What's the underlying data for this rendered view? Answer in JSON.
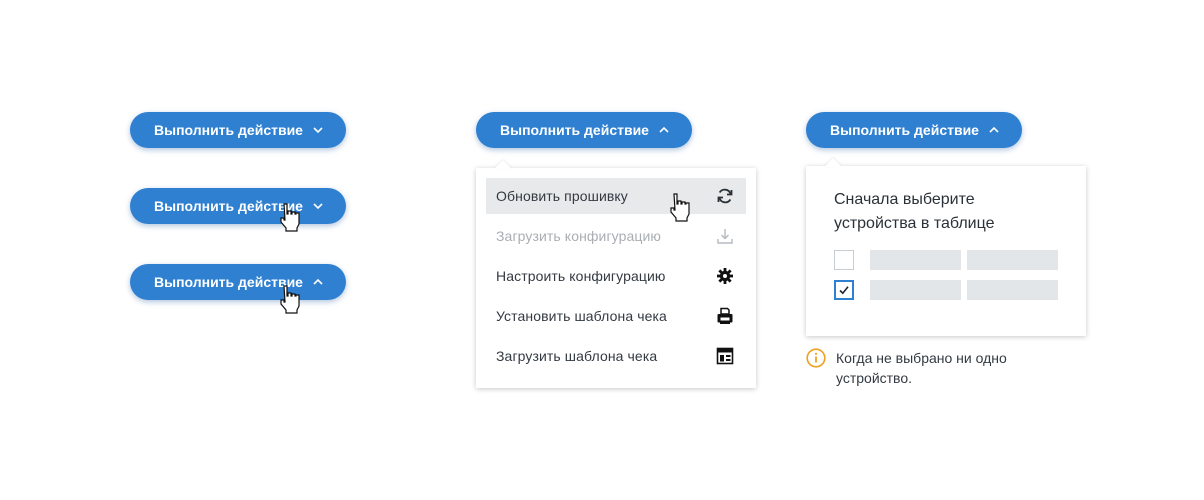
{
  "action_button": {
    "label": "Выполнить действие"
  },
  "menu": {
    "items": [
      {
        "label": "Обновить прошивку",
        "icon": "refresh-icon",
        "state": "hover"
      },
      {
        "label": "Загрузить конфигурацию",
        "icon": "download-icon",
        "state": "disabled"
      },
      {
        "label": "Настроить конфигурацию",
        "icon": "gear-icon",
        "state": "normal"
      },
      {
        "label": "Установить шаблона чека",
        "icon": "printer-icon",
        "state": "normal"
      },
      {
        "label": "Загрузить шаблона чека",
        "icon": "template-icon",
        "state": "normal"
      }
    ]
  },
  "hint_popover": {
    "title": "Сначала выберите устройства в таблице",
    "checkboxes": [
      {
        "checked": false
      },
      {
        "checked": true
      }
    ]
  },
  "note": {
    "icon": "info-icon",
    "text": "Когда не выбрано ни одно устройство."
  },
  "colors": {
    "accent": "#2f80d1",
    "hover_bg": "#e7e9eb",
    "disabled_text": "#a9aeb3",
    "skeleton": "#e3e6e9",
    "info_icon": "#f0a020"
  }
}
